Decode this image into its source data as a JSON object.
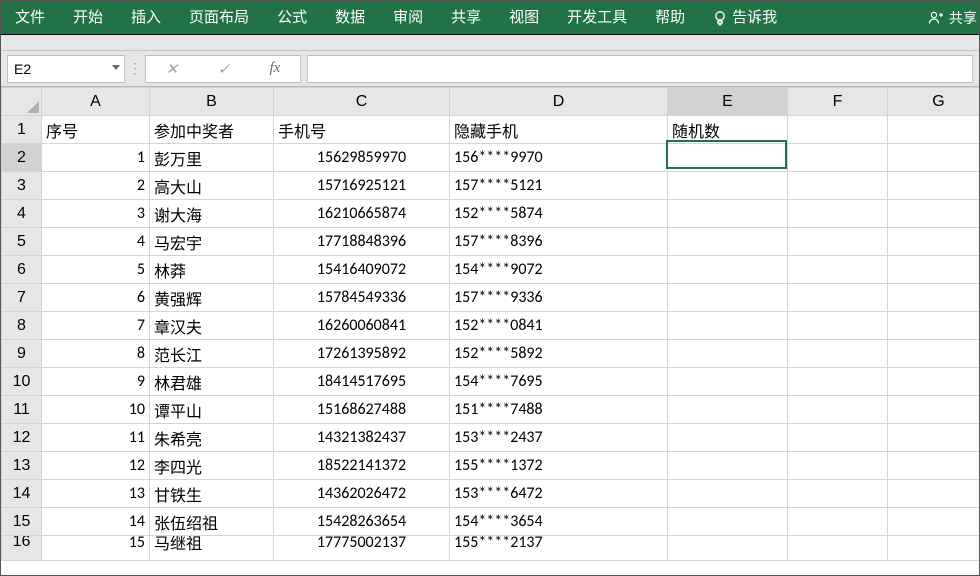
{
  "menu": {
    "file": "文件",
    "home": "开始",
    "insert": "插入",
    "layout": "页面布局",
    "formula": "公式",
    "data": "数据",
    "review": "审阅",
    "share_tab": "共享",
    "view": "视图",
    "dev": "开发工具",
    "help": "帮助",
    "tellme": "告诉我",
    "share": "共享"
  },
  "namebox": "E2",
  "fx_label": "fx",
  "formula_value": "",
  "columns": [
    "A",
    "B",
    "C",
    "D",
    "E",
    "F",
    "G"
  ],
  "headers": {
    "A": "序号",
    "B": "参加中奖者",
    "C": "手机号",
    "D": "隐藏手机",
    "E": "随机数",
    "F": "",
    "G": ""
  },
  "rows": [
    {
      "n": 1,
      "seq": "1",
      "name": "彭万里",
      "phone": "15629859970",
      "mask": "156****9970"
    },
    {
      "n": 2,
      "seq": "2",
      "name": "高大山",
      "phone": "15716925121",
      "mask": "157****5121"
    },
    {
      "n": 3,
      "seq": "3",
      "name": "谢大海",
      "phone": "16210665874",
      "mask": "152****5874"
    },
    {
      "n": 4,
      "seq": "4",
      "name": "马宏宇",
      "phone": "17718848396",
      "mask": "157****8396"
    },
    {
      "n": 5,
      "seq": "5",
      "name": "林莽",
      "phone": "15416409072",
      "mask": "154****9072"
    },
    {
      "n": 6,
      "seq": "6",
      "name": "黄强辉",
      "phone": "15784549336",
      "mask": "157****9336"
    },
    {
      "n": 7,
      "seq": "7",
      "name": "章汉夫",
      "phone": "16260060841",
      "mask": "152****0841"
    },
    {
      "n": 8,
      "seq": "8",
      "name": "范长江",
      "phone": "17261395892",
      "mask": "152****5892"
    },
    {
      "n": 9,
      "seq": "9",
      "name": "林君雄",
      "phone": "18414517695",
      "mask": "154****7695"
    },
    {
      "n": 10,
      "seq": "10",
      "name": "谭平山",
      "phone": "15168627488",
      "mask": "151****7488"
    },
    {
      "n": 11,
      "seq": "11",
      "name": "朱希亮",
      "phone": "14321382437",
      "mask": "153****2437"
    },
    {
      "n": 12,
      "seq": "12",
      "name": "李四光",
      "phone": "18522141372",
      "mask": "155****1372"
    },
    {
      "n": 13,
      "seq": "13",
      "name": "甘铁生",
      "phone": "14362026472",
      "mask": "153****6472"
    },
    {
      "n": 14,
      "seq": "14",
      "name": "张伍绍祖",
      "phone": "15428263654",
      "mask": "154****3654"
    },
    {
      "n": 15,
      "seq": "15",
      "name": "马继祖",
      "phone": "17775002137",
      "mask": "155****2137"
    }
  ],
  "colors": {
    "ribbon": "#217346",
    "grid_border": "#d4d4d4",
    "header_bg": "#e6e6e6"
  }
}
